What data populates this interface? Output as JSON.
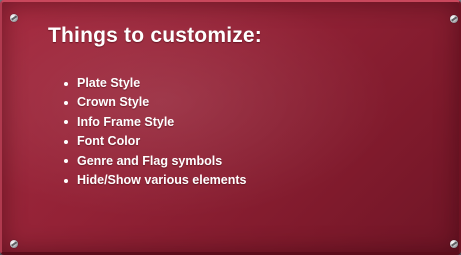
{
  "slide": {
    "title": "Things to customize:",
    "items": [
      "Plate Style",
      "Crown Style",
      "Info Frame Style",
      "Font Color",
      "Genre and Flag symbols",
      "Hide/Show various elements"
    ]
  },
  "colors": {
    "plate": "#932236",
    "plate_dark": "#6f1526",
    "text": "#ffffff",
    "background": "#5a5e66"
  },
  "icons": {
    "screws": [
      "screw-icon",
      "screw-icon",
      "screw-icon",
      "screw-icon"
    ],
    "bullet": "bullet-icon"
  }
}
